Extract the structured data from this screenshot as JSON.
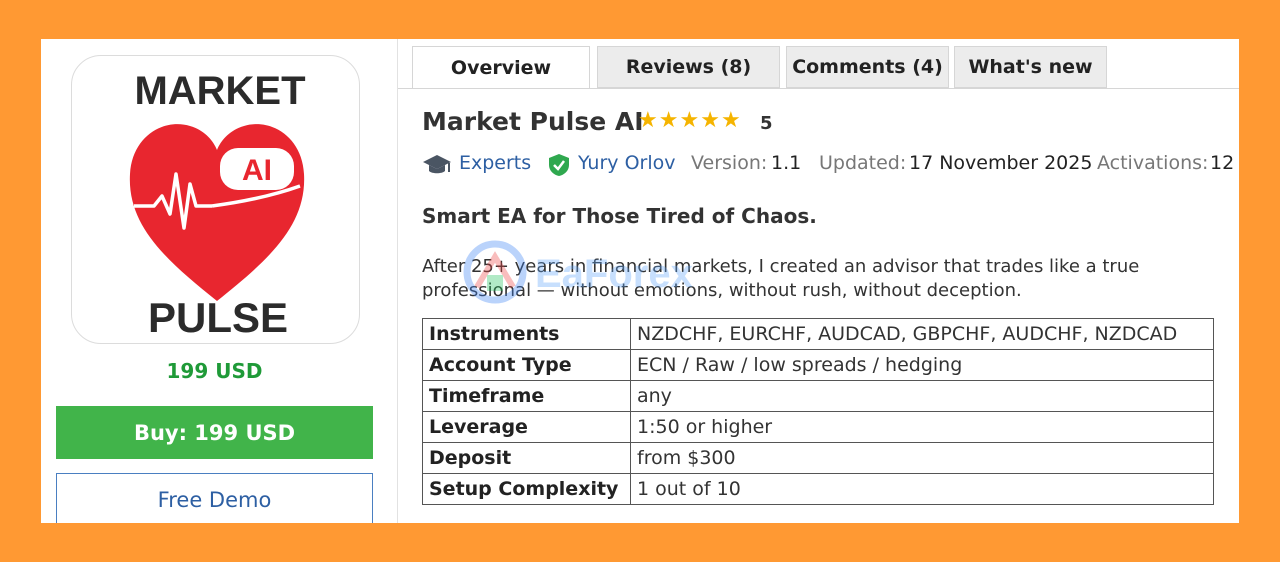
{
  "product": {
    "logo_text_top": "MARKET",
    "logo_text_badge": "AI",
    "logo_text_bottom": "PULSE",
    "price": "199 USD",
    "buy_label": "Buy: 199 USD",
    "demo_label": "Free Demo"
  },
  "tabs": [
    {
      "label": "Overview",
      "active": true
    },
    {
      "label": "Reviews (8)",
      "active": false
    },
    {
      "label": "Comments (4)",
      "active": false
    },
    {
      "label": "What's new",
      "active": false
    }
  ],
  "header": {
    "title": "Market Pulse AI",
    "rating_stars": 5,
    "rating_value": "5"
  },
  "meta": {
    "category": "Experts",
    "category_icon": "graduation-cap-icon",
    "author": "Yury Orlov",
    "author_icon": "verified-shield-icon",
    "version_label": "Version:",
    "version_value": "1.1",
    "updated_label": "Updated:",
    "updated_value": "17 November 2025",
    "activations_label": "Activations:",
    "activations_value": "12"
  },
  "content": {
    "subheading": "Smart EA for Those Tired of Chaos.",
    "description": "After 25+ years in financial markets, I created an advisor that trades like a true professional — without emotions, without rush, without deception.",
    "watermark": "EaForex"
  },
  "specs": [
    {
      "key": "Instruments",
      "value": "NZDCHF, EURCHF, AUDCAD, GBPCHF, AUDCHF, NZDCAD"
    },
    {
      "key": "Account Type",
      "value": "ECN / Raw / low spreads / hedging"
    },
    {
      "key": "Timeframe",
      "value": "any"
    },
    {
      "key": "Leverage",
      "value": "1:50 or higher"
    },
    {
      "key": "Deposit",
      "value": "from $300"
    },
    {
      "key": "Setup Complexity",
      "value": "1 out of 10"
    }
  ],
  "colors": {
    "frame": "#ff9933",
    "price_green": "#1f9a38",
    "buy_green": "#41b44a",
    "link_blue": "#2d5fa3",
    "star_gold": "#f5b400",
    "heart_red": "#e8262f"
  }
}
